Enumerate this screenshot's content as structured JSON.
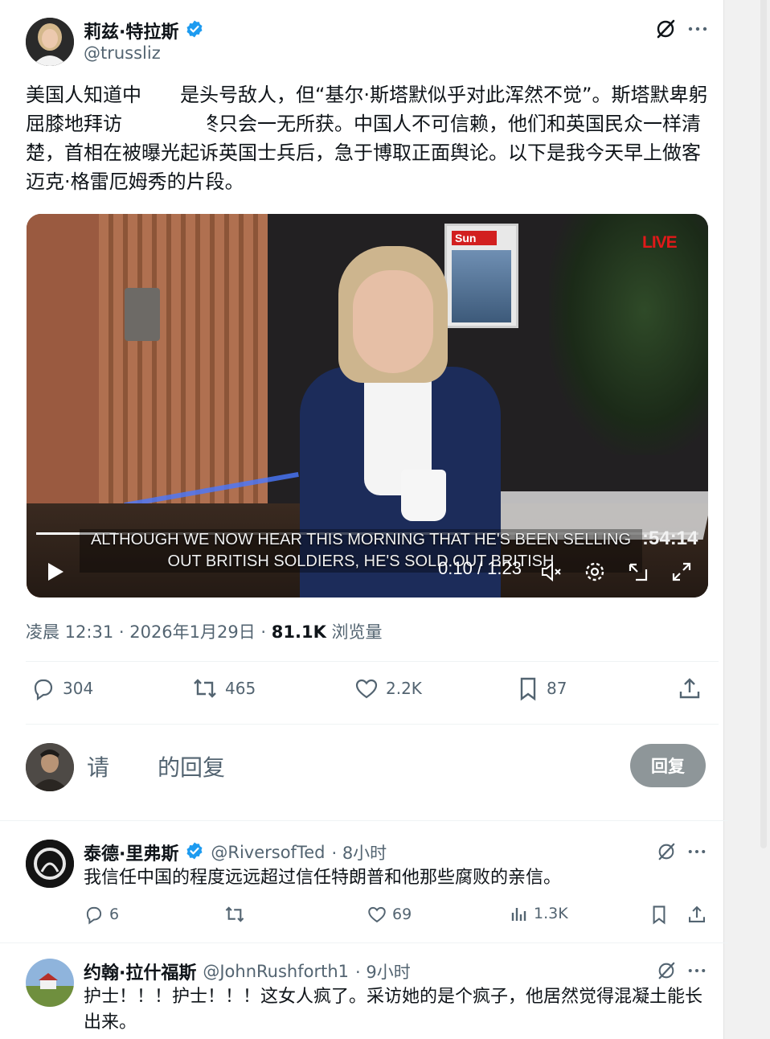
{
  "main_tweet": {
    "author_name": "莉兹·特拉斯",
    "author_handle": "@trussliz",
    "text": "美国人知道中　　是头号敌人，但“基尔·斯塔默似乎对此浑然不觉”。斯塔默卑躬屈膝地拜访　　　最终只会一无所获。中国人不可信赖，他们和英国民众一样清楚，首相在被曝光起诉英国士兵后，急于博取正面舆论。以下是我今天早上做客迈克·格雷厄姆秀的片段。",
    "video": {
      "live_badge": "LIVE",
      "poster_masthead": "Sun",
      "caption_line1": "ALTHOUGH WE NOW HEAR THIS MORNING THAT HE'S BEEN SELLING",
      "caption_line2": "OUT BRITISH SOLDIERS, HE'S SOLD OUT BRITISH",
      "broadcast_clock": ":54:14",
      "time_display": "0:10 / 1:23",
      "progress": 0.12
    },
    "timestamp": "凌晨 12:31 · 2026年1月29日 · ",
    "views_count": "81.1K",
    "views_label": " 浏览量",
    "stats": {
      "replies": "304",
      "reposts": "465",
      "likes": "2.2K",
      "bookmarks": "87"
    }
  },
  "reply_box": {
    "placeholder_a": "请",
    "placeholder_b": "的回复",
    "button_label": "回复"
  },
  "comments": [
    {
      "author_name": "泰德·里弗斯",
      "author_handle": "@RiversofTed",
      "time": "· 8小时",
      "text": "我信任中国的程度远远超过信任特朗普和他那些腐败的亲信。",
      "replies": "6",
      "reposts": "",
      "likes": "69",
      "views": "1.3K"
    },
    {
      "author_name": "约翰·拉什福斯",
      "author_handle": "@JohnRushforth1",
      "time": "· 9小时",
      "text": "护士！！！护士！！！这女人疯了。采访她的是个疯子，他居然觉得混凝土能长出来。"
    }
  ],
  "colors": {
    "text_primary": "#0f1419",
    "text_secondary": "#536471",
    "verified_blue": "#1d9bf0",
    "live_red": "#e11919",
    "reply_button": "#8e9699"
  }
}
